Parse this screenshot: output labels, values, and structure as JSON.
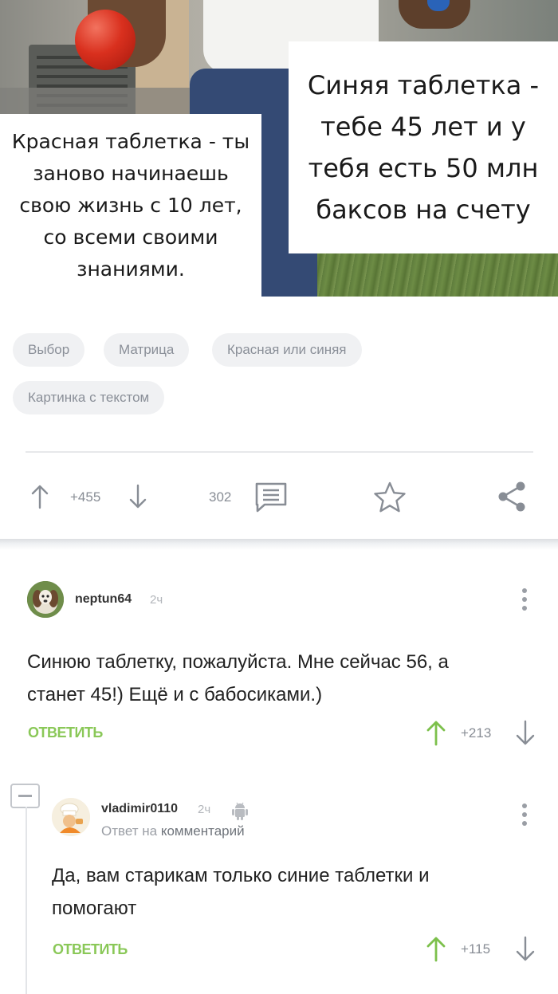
{
  "post_image": {
    "left_caption": "Красная таблетка - ты заново начинаешь свою жизнь с 10 лет, со всеми своими знаниями.",
    "right_caption": "Синяя таблетка - тебе 45 лет и у тебя есть 50 млн баксов на счету"
  },
  "tags": [
    "Выбор",
    "Матрица",
    "Красная или синяя",
    "Картинка с текстом"
  ],
  "post_actions": {
    "rating": "+455",
    "comments_count": "302",
    "icons": [
      "arrow-up-icon",
      "arrow-down-icon",
      "comments-icon",
      "star-icon",
      "share-icon"
    ]
  },
  "comments": [
    {
      "username": "neptun64",
      "time": "2ч",
      "text": "Синюю таблетку, пожалуйста. Мне сейчас 56, а станет 45!) Ещё и с бабосиками.)",
      "reply_label": "ОТВЕТИТЬ",
      "score": "+213"
    },
    {
      "username": "vladimir0110",
      "time": "2ч",
      "platform_icon": "android-icon",
      "reply_to_prefix": "Ответ на",
      "reply_to_target": "комментарий",
      "text": "Да, вам старикам только синие таблетки и помогают",
      "reply_label": "ОТВЕТИТЬ",
      "score": "+115"
    }
  ],
  "colors": {
    "reply_green": "#8ac858",
    "upvote_green": "#7cc04b",
    "muted_gray": "#888d95",
    "tag_bg": "#f0f1f3"
  }
}
